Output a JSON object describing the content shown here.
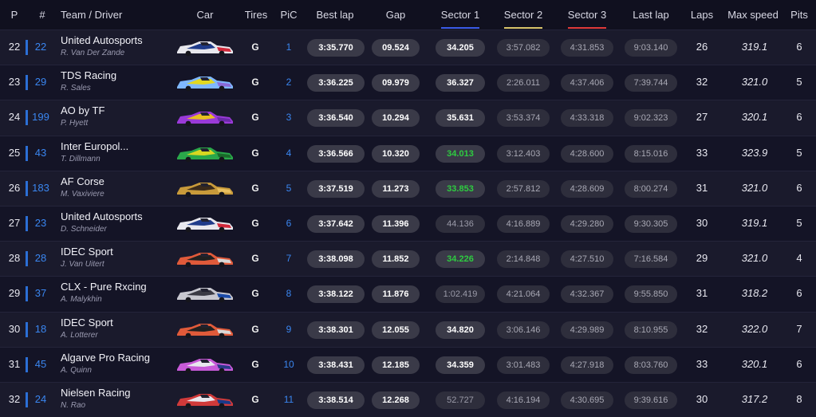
{
  "header": {
    "p": "P",
    "num": "#",
    "team_driver": "Team / Driver",
    "car": "Car",
    "tires": "Tires",
    "pic": "PiC",
    "best_lap": "Best lap",
    "gap": "Gap",
    "sector1": "Sector 1",
    "sector2": "Sector 2",
    "sector3": "Sector 3",
    "last_lap": "Last lap",
    "laps": "Laps",
    "max_speed": "Max speed",
    "pits": "Pits"
  },
  "sector_colors": {
    "s1": "#3a5be8",
    "s2": "#d8c46a",
    "s3": "#e03a3a"
  },
  "rows": [
    {
      "pos": "22",
      "num": "22",
      "team": "United Autosports",
      "driver": "R. Van Der Zande",
      "livery": [
        "#e8e8ee",
        "#1f3b8a",
        "#d0283a"
      ],
      "tires": "G",
      "pic": "1",
      "best": "3:35.770",
      "gap": "09.524",
      "s1": "34.205",
      "s1_style": "white",
      "s2": "3:57.082",
      "s3": "4:31.853",
      "last": "9:03.140",
      "laps": "26",
      "max_speed": "319.1",
      "pits": "6"
    },
    {
      "pos": "23",
      "num": "29",
      "team": "TDS Racing",
      "driver": "R. Sales",
      "livery": [
        "#7fb8ff",
        "#e2d820",
        "#8a6ad8"
      ],
      "tires": "G",
      "pic": "2",
      "best": "3:36.225",
      "gap": "09.979",
      "s1": "36.327",
      "s1_style": "white",
      "s2": "2:26.011",
      "s3": "4:37.406",
      "last": "7:39.744",
      "laps": "32",
      "max_speed": "321.0",
      "pits": "5"
    },
    {
      "pos": "24",
      "num": "199",
      "team": "AO by TF",
      "driver": "P. Hyett",
      "livery": [
        "#9a3ad8",
        "#e8c020",
        "#6a2aa8"
      ],
      "tires": "G",
      "pic": "3",
      "best": "3:36.540",
      "gap": "10.294",
      "s1": "35.631",
      "s1_style": "white",
      "s2": "3:53.374",
      "s3": "4:33.318",
      "last": "9:02.323",
      "laps": "27",
      "max_speed": "320.1",
      "pits": "6"
    },
    {
      "pos": "25",
      "num": "43",
      "team": "Inter Europol...",
      "driver": "T. Dillmann",
      "livery": [
        "#2aa84a",
        "#d8d820",
        "#1a6a2a"
      ],
      "tires": "G",
      "pic": "4",
      "best": "3:36.566",
      "gap": "10.320",
      "s1": "34.013",
      "s1_style": "green",
      "s2": "3:12.403",
      "s3": "4:28.600",
      "last": "8:15.016",
      "laps": "33",
      "max_speed": "323.9",
      "pits": "5"
    },
    {
      "pos": "26",
      "num": "183",
      "team": "AF Corse",
      "driver": "M. Vaxiviere",
      "livery": [
        "#c89a3a",
        "#3a2a1a",
        "#e8c060"
      ],
      "tires": "G",
      "pic": "5",
      "best": "3:37.519",
      "gap": "11.273",
      "s1": "33.853",
      "s1_style": "green",
      "s2": "2:57.812",
      "s3": "4:28.609",
      "last": "8:00.274",
      "laps": "31",
      "max_speed": "321.0",
      "pits": "6"
    },
    {
      "pos": "27",
      "num": "23",
      "team": "United Autosports",
      "driver": "D. Schneider",
      "livery": [
        "#e8e8ee",
        "#1f3b8a",
        "#d0283a"
      ],
      "tires": "G",
      "pic": "6",
      "best": "3:37.642",
      "gap": "11.396",
      "s1": "44.136",
      "s1_style": "dim",
      "s2": "4:16.889",
      "s3": "4:29.280",
      "last": "9:30.305",
      "laps": "30",
      "max_speed": "319.1",
      "pits": "5"
    },
    {
      "pos": "28",
      "num": "28",
      "team": "IDEC Sport",
      "driver": "J. Van Uitert",
      "livery": [
        "#e05a3a",
        "#202020",
        "#d8d8d8"
      ],
      "tires": "G",
      "pic": "7",
      "best": "3:38.098",
      "gap": "11.852",
      "s1": "34.226",
      "s1_style": "green",
      "s2": "2:14.848",
      "s3": "4:27.510",
      "last": "7:16.584",
      "laps": "29",
      "max_speed": "321.0",
      "pits": "4"
    },
    {
      "pos": "29",
      "num": "37",
      "team": "CLX - Pure Rxcing",
      "driver": "A. Malykhin",
      "livery": [
        "#c8c8d0",
        "#3a3a44",
        "#1a4aa8"
      ],
      "tires": "G",
      "pic": "8",
      "best": "3:38.122",
      "gap": "11.876",
      "s1": "1:02.419",
      "s1_style": "dim",
      "s2": "4:21.064",
      "s3": "4:32.367",
      "last": "9:55.850",
      "laps": "31",
      "max_speed": "318.2",
      "pits": "6"
    },
    {
      "pos": "30",
      "num": "18",
      "team": "IDEC Sport",
      "driver": "A. Lotterer",
      "livery": [
        "#e05a3a",
        "#202020",
        "#d8d8d8"
      ],
      "tires": "G",
      "pic": "9",
      "best": "3:38.301",
      "gap": "12.055",
      "s1": "34.820",
      "s1_style": "white",
      "s2": "3:06.146",
      "s3": "4:29.989",
      "last": "8:10.955",
      "laps": "32",
      "max_speed": "322.0",
      "pits": "7"
    },
    {
      "pos": "31",
      "num": "45",
      "team": "Algarve Pro Racing",
      "driver": "A. Quinn",
      "livery": [
        "#c85ad8",
        "#e8e8ee",
        "#2a3a8a"
      ],
      "tires": "G",
      "pic": "10",
      "best": "3:38.431",
      "gap": "12.185",
      "s1": "34.359",
      "s1_style": "white",
      "s2": "3:01.483",
      "s3": "4:27.918",
      "last": "8:03.760",
      "laps": "33",
      "max_speed": "320.1",
      "pits": "6"
    },
    {
      "pos": "32",
      "num": "24",
      "team": "Nielsen Racing",
      "driver": "N. Rao",
      "livery": [
        "#d03a3a",
        "#e8e8ee",
        "#1a3a8a"
      ],
      "tires": "G",
      "pic": "11",
      "best": "3:38.514",
      "gap": "12.268",
      "s1": "52.727",
      "s1_style": "dim",
      "s2": "4:16.194",
      "s3": "4:30.695",
      "last": "9:39.616",
      "laps": "30",
      "max_speed": "317.2",
      "pits": "8"
    }
  ]
}
